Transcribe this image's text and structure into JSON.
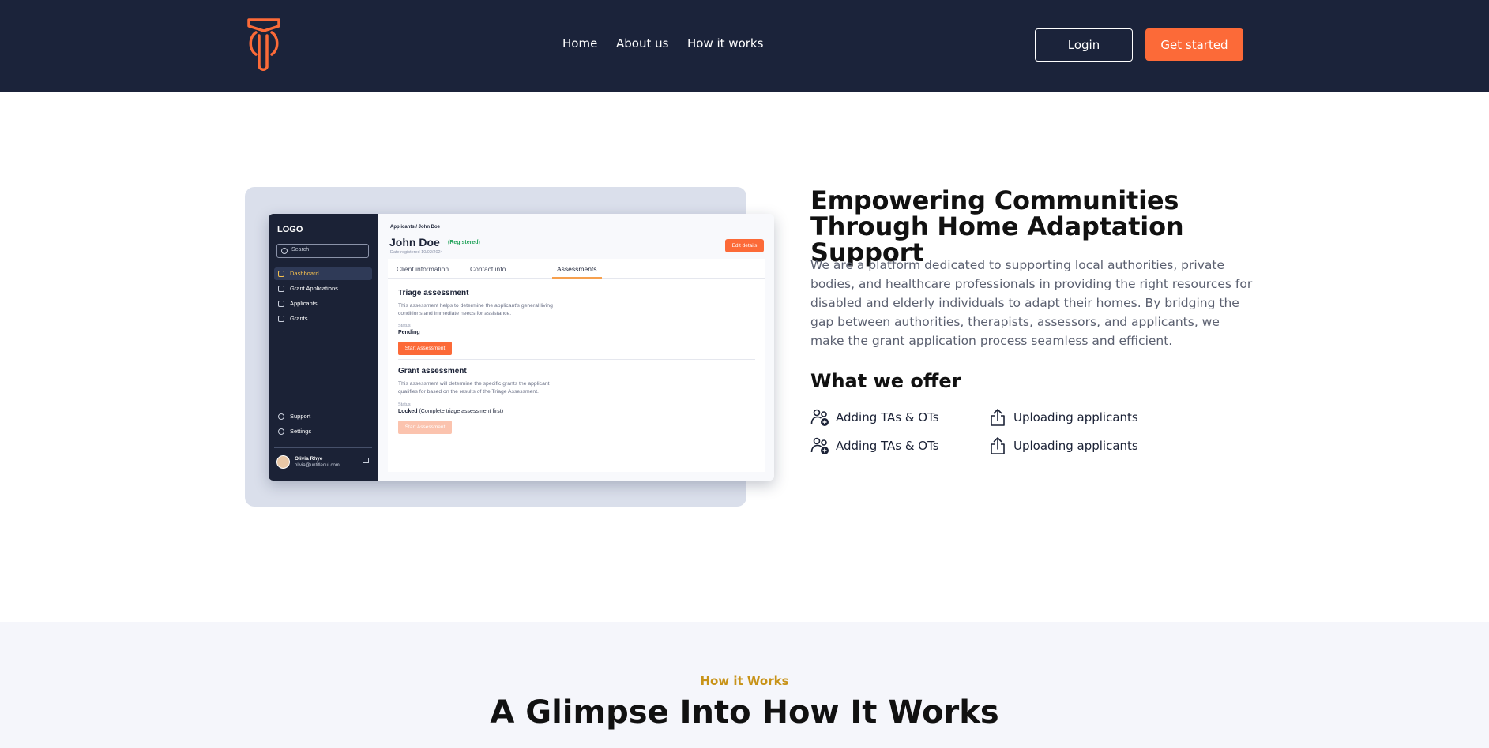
{
  "nav": {
    "links": [
      "Home",
      "About us",
      "How it works"
    ],
    "login_label": "Login",
    "get_started_label": "Get started"
  },
  "brand": {
    "accent": "#fc6a38",
    "navy": "#1b233a",
    "gold": "#c89318"
  },
  "mock_app": {
    "logo": "LOGO",
    "search_placeholder": "Search",
    "nav_items": [
      "Dashboard",
      "Grant Applications",
      "Applicants",
      "Grants"
    ],
    "bottom_items": [
      "Support",
      "Settings"
    ],
    "user_name": "Olivia Rhye",
    "user_email": "olivia@untitledui.com",
    "breadcrumb": "Applicants / John Doe",
    "client_name": "John Doe",
    "status": "(Registered)",
    "date_registered": "Date registered 10/02/2024",
    "edit_label": "Edit details",
    "tabs": [
      "Client information",
      "Contact info",
      "Assessments"
    ],
    "triage": {
      "title": "Triage assessment",
      "desc": "This assessment helps to determine the applicant's general living conditions and immediate needs for assistance.",
      "status_label": "Status",
      "status_value": "Pending",
      "button": "Start Assessment"
    },
    "grant": {
      "title": "Grant assessment",
      "desc": "This assessment will determine the specific grants the applicant qualifies for based on the results of the Triage Assessment.",
      "status_label": "Status",
      "status_value": "Locked",
      "status_note": "(Complete triage assessment first)",
      "button": "Start Assessment"
    }
  },
  "hero": {
    "title": "Empowering Communities Through Home Adaptation Support",
    "description": "We are a platform dedicated to supporting local authorities, private bodies, and healthcare professionals in providing the right resources for disabled and elderly individuals to adapt their homes. By bridging the gap between authorities, therapists, assessors, and applicants, we make the grant application process seamless and efficient.",
    "offer_title": "What we offer",
    "offers": [
      {
        "label": "Adding TAs & OTs",
        "icon": "add-users-icon"
      },
      {
        "label": "Uploading applicants",
        "icon": "upload-icon"
      },
      {
        "label": "Adding TAs & OTs",
        "icon": "add-users-icon"
      },
      {
        "label": "Uploading applicants",
        "icon": "upload-icon"
      }
    ]
  },
  "how": {
    "kicker": "How it Works",
    "title": "A Glimpse Into How It Works"
  }
}
